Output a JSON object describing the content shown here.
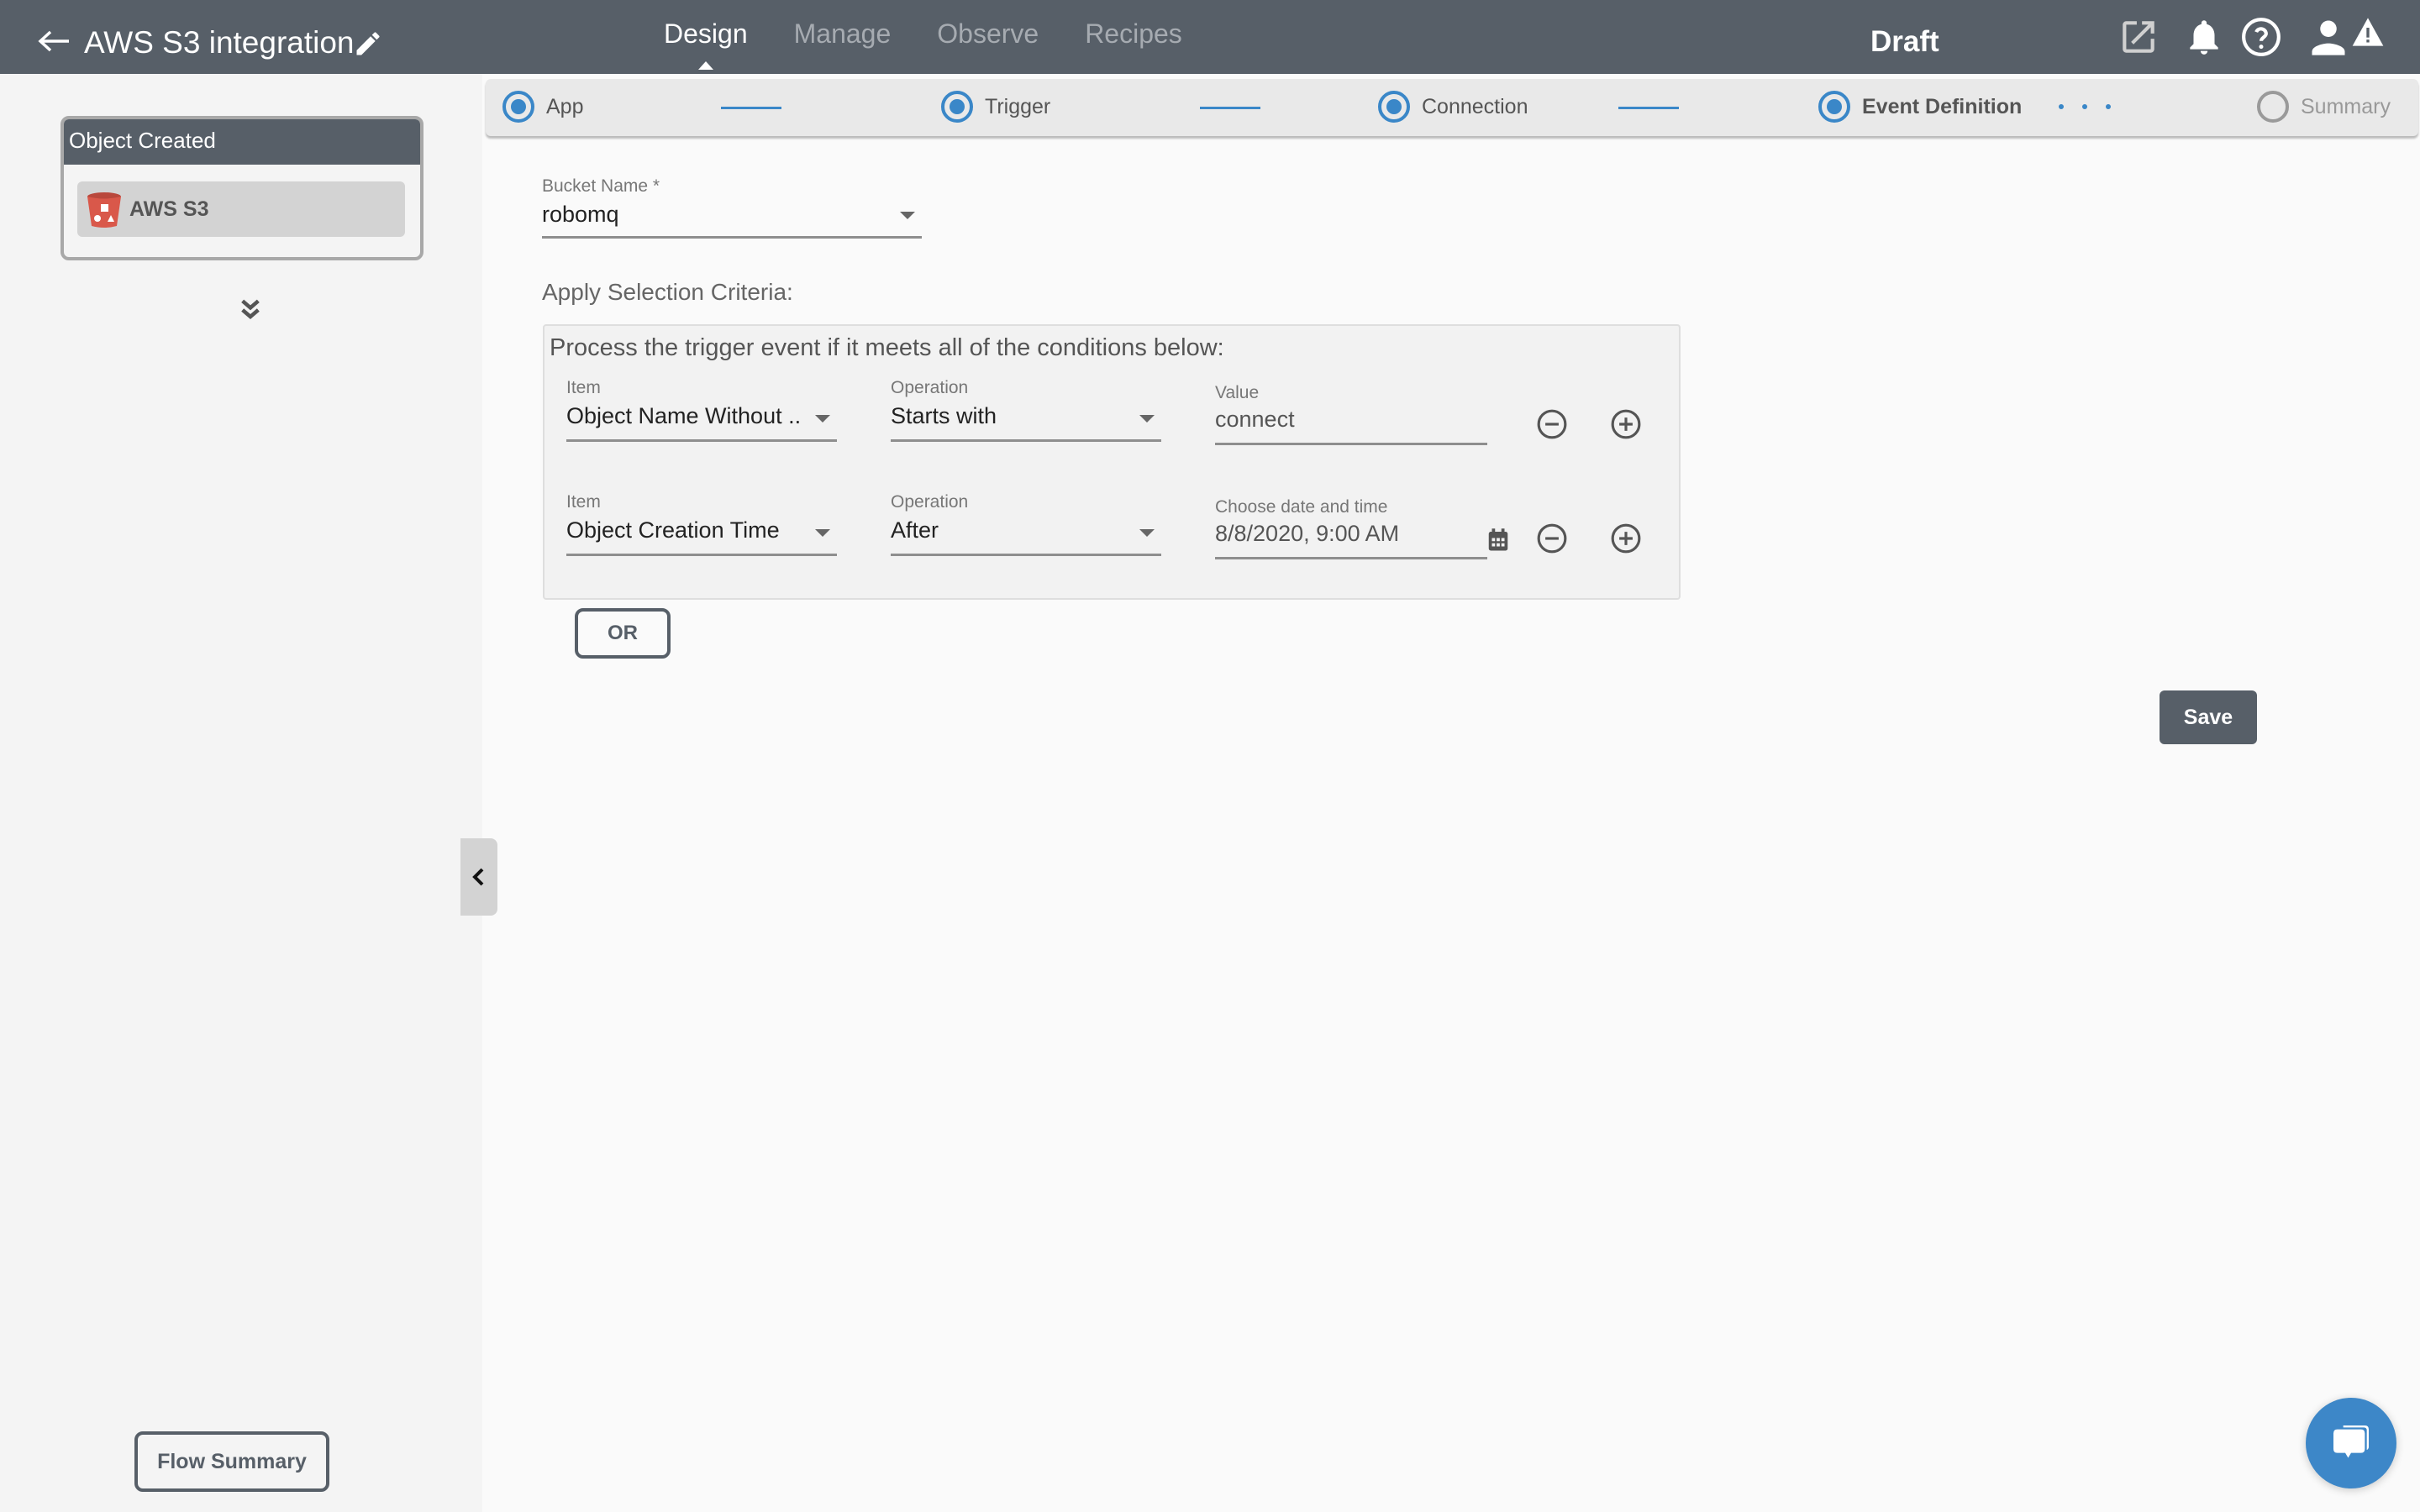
{
  "header": {
    "title": "AWS S3 integration",
    "nav": [
      {
        "label": "Design",
        "active": true
      },
      {
        "label": "Manage",
        "active": false
      },
      {
        "label": "Observe",
        "active": false
      },
      {
        "label": "Recipes",
        "active": false
      }
    ],
    "status": "Draft",
    "icons": [
      "external-link-icon",
      "bell-icon",
      "help-icon",
      "user-icon",
      "warning-icon"
    ]
  },
  "sidebar": {
    "node": {
      "title": "Object Created",
      "app_label": "AWS S3"
    },
    "flow_summary_label": "Flow Summary"
  },
  "stepper": {
    "steps": [
      {
        "label": "App",
        "state": "done"
      },
      {
        "label": "Trigger",
        "state": "done"
      },
      {
        "label": "Connection",
        "state": "done"
      },
      {
        "label": "Event Definition",
        "state": "current"
      },
      {
        "label": "Summary",
        "state": "pending"
      }
    ]
  },
  "form": {
    "bucket": {
      "label": "Bucket Name *",
      "value": "robomq"
    },
    "criteria_title": "Apply Selection Criteria:",
    "criteria_intro": "Process the trigger event if it meets all of the conditions below:",
    "conditions": [
      {
        "item_label": "Item",
        "item_value": "Object Name Without ...",
        "operation_label": "Operation",
        "operation_value": "Starts with",
        "value_label": "Value",
        "value": "connect"
      },
      {
        "item_label": "Item",
        "item_value": "Object Creation Time",
        "operation_label": "Operation",
        "operation_value": "After",
        "value_label": "Choose date and time",
        "value": "8/8/2020, 9:00 AM"
      }
    ],
    "or_label": "OR",
    "save_label": "Save"
  },
  "colors": {
    "header_bg": "#575f68",
    "accent": "#3a87c8",
    "chat_bubble": "#3d87c8",
    "s3_red": "#d9584a"
  }
}
